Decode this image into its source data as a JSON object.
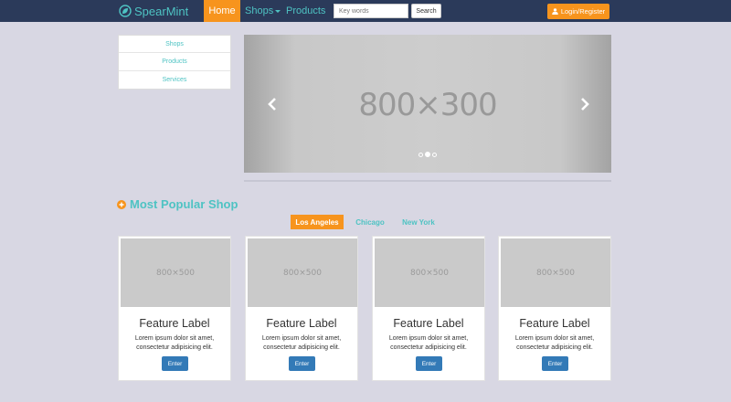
{
  "navbar": {
    "brand": "SpearMint",
    "home_label": "Home",
    "shops_label": "Shops",
    "products_label": "Products",
    "search_placeholder": "Key words",
    "search_button": "Search",
    "login_label": "Login/Register"
  },
  "sidebar": {
    "items": [
      {
        "label": "Shops"
      },
      {
        "label": "Products"
      },
      {
        "label": "Services"
      }
    ]
  },
  "carousel": {
    "image_text": "800×300",
    "slide_count": 3,
    "active_slide": 2
  },
  "section": {
    "title": "Most Popular Shop"
  },
  "city_tabs": [
    {
      "label": "Los Angeles",
      "active": true
    },
    {
      "label": "Chicago",
      "active": false
    },
    {
      "label": "New York",
      "active": false
    }
  ],
  "cards": [
    {
      "image_text": "800×500",
      "title": "Feature Label",
      "text": "Lorem ipsum dolor sit amet, consectetur adipisicing elit.",
      "button": "Enter"
    },
    {
      "image_text": "800×500",
      "title": "Feature Label",
      "text": "Lorem ipsum dolor sit amet, consectetur adipisicing elit.",
      "button": "Enter"
    },
    {
      "image_text": "800×500",
      "title": "Feature Label",
      "text": "Lorem ipsum dolor sit amet, consectetur adipisicing elit.",
      "button": "Enter"
    },
    {
      "image_text": "800×500",
      "title": "Feature Label",
      "text": "Lorem ipsum dolor sit amet, consectetur adipisicing elit.",
      "button": "Enter"
    }
  ],
  "colors": {
    "navbar_bg": "#2b3a5a",
    "accent_orange": "#f7941d",
    "accent_teal": "#4ec3c3",
    "button_blue": "#337ab7",
    "page_bg": "#d8d7e3"
  },
  "icons": {
    "brand": "leaf-logo-icon",
    "login": "user-icon",
    "section": "plus-circle-icon",
    "carousel_prev": "chevron-left-icon",
    "carousel_next": "chevron-right-icon"
  }
}
